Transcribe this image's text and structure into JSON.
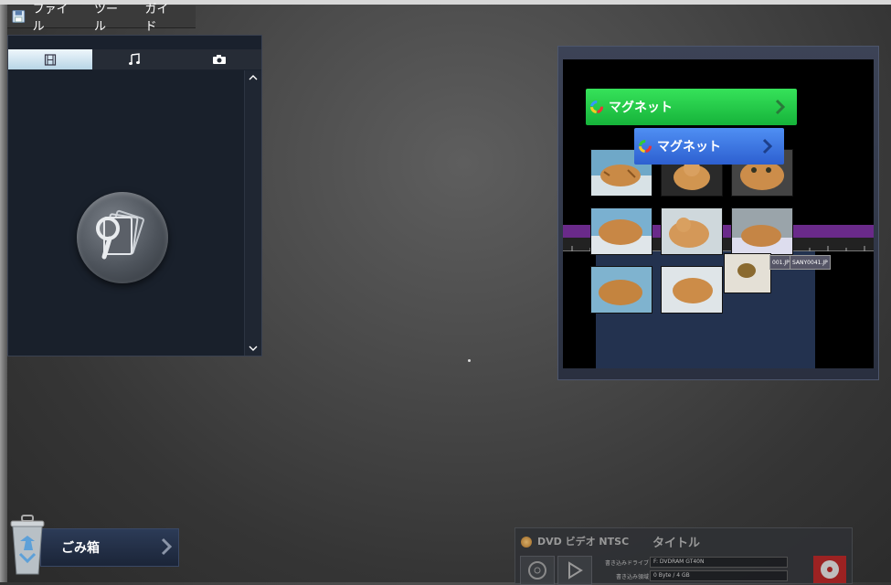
{
  "menubar": {
    "items": [
      "ファイル",
      "ツール",
      "ガイド"
    ]
  },
  "media_panel": {
    "tabs": [
      "film-tab",
      "music-tab",
      "photo-tab"
    ],
    "active_tab": 0
  },
  "preview": {
    "button_green": "マグネット",
    "button_blue": "マグネット",
    "clip_label_1": "001.JP",
    "clip_label_2": "SANY0041.JP"
  },
  "trash": {
    "label": "ごみ箱"
  },
  "dvd": {
    "format": "DVD ビデオ NTSC",
    "title": "タイトル",
    "drive_label": "書き込みドライブ",
    "drive_value": "F: DVDRAM GT40N",
    "space_label": "書き込み領域",
    "space_value": "0 Byte / 4 GB"
  },
  "colors": {
    "accent_green": "#1ec44a",
    "accent_blue": "#3a74e0",
    "panel_bg": "#1a212d",
    "purple": "#6a2a8a"
  }
}
